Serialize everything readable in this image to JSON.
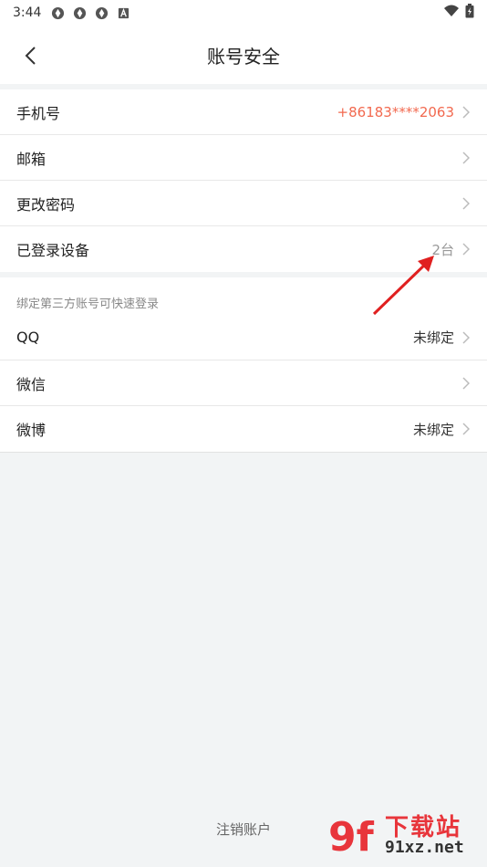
{
  "status_bar": {
    "time": "3:44",
    "app_icons": [
      "notification-icon",
      "notification-icon",
      "notification-icon",
      "a-icon"
    ]
  },
  "header": {
    "title": "账号安全"
  },
  "account_rows": [
    {
      "label": "手机号",
      "value": "+86183****2063"
    },
    {
      "label": "邮箱",
      "value": ""
    },
    {
      "label": "更改密码",
      "value": ""
    },
    {
      "label": "已登录设备",
      "value": "2台"
    }
  ],
  "third_party": {
    "caption": "绑定第三方账号可快速登录",
    "rows": [
      {
        "label": "QQ",
        "value": "未绑定"
      },
      {
        "label": "微信",
        "value": ""
      },
      {
        "label": "微博",
        "value": "未绑定"
      }
    ]
  },
  "footer": {
    "deactivate": "注销账户"
  },
  "watermark": {
    "logo": "9f",
    "line1": "下载站",
    "line2": "91xz.net"
  },
  "colors": {
    "accent": "#f2694f",
    "background": "#f2f4f5",
    "arrow": "#e02020"
  }
}
